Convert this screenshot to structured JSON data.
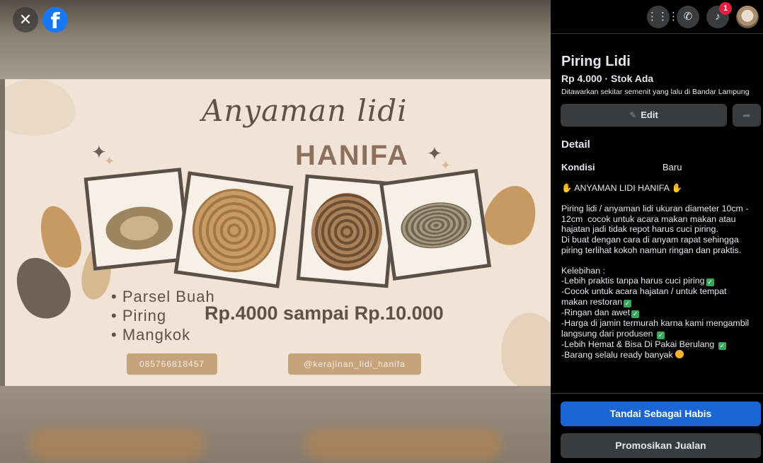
{
  "viewer": {
    "close_icon": "close-icon",
    "logo_icon": "facebook-logo-icon",
    "logo_glyph": "f",
    "poster": {
      "script_title": "Anyaman lidi",
      "brand": "HANIFA",
      "items": [
        "Parsel Buah",
        "Piring",
        "Mangkok"
      ],
      "price_range": "Rp.4000 sampai Rp.10.000",
      "phone": "085766818457",
      "instagram": "@kerajinan_lidi_hanifa"
    }
  },
  "topbar": {
    "menu_icon": "grid-menu-icon",
    "messenger_icon": "messenger-icon",
    "notifications_icon": "bell-icon",
    "notification_count": "1",
    "avatar_icon": "profile-avatar"
  },
  "listing": {
    "title": "Piring Lidi",
    "price_stock": "Rp 4.000 · Stok Ada",
    "listed": "Ditawarkan sekitar semenit yang lalu di Bandar Lampung",
    "edit_label": "Edit",
    "share_icon": "share-icon",
    "detail_heading": "Detail",
    "condition_label": "Kondisi",
    "condition_value": "Baru",
    "description_lines": [
      "ANYAMAN LIDI HANIFA",
      "",
      "Piring lidi / anyaman lidi ukuran diameter 10cm -",
      "12cm  cocok untuk acara makan makan atau",
      "hajatan jadi tidak repot harus cuci piring.",
      "Di buat dengan cara di anyam rapat sehingga",
      "piring terlihat kokoh namun ringan dan praktis.",
      "",
      "Kelebihan :",
      "-Lebih praktis tanpa harus cuci piring",
      "-Cocok untuk acara hajatan / untuk tempat",
      "makan restoran",
      "-Ringan dan awet",
      "-Harga di jamin termurah karna kami mengambil",
      "langsung dari produsen",
      "-Lebih Hemat & Bisa Di Pakai Berulang",
      "-Barang selalu ready banyak"
    ],
    "mark_sold_label": "Tandai Sebagai Habis",
    "promote_label": "Promosikan Jualan"
  },
  "colors": {
    "primary_button": "#1b66d6",
    "panel_bg": "#000000",
    "secondary_button": "#3a3b3c",
    "check_emoji": "#3aa55c",
    "poster_bg": "#f1e4d6"
  }
}
